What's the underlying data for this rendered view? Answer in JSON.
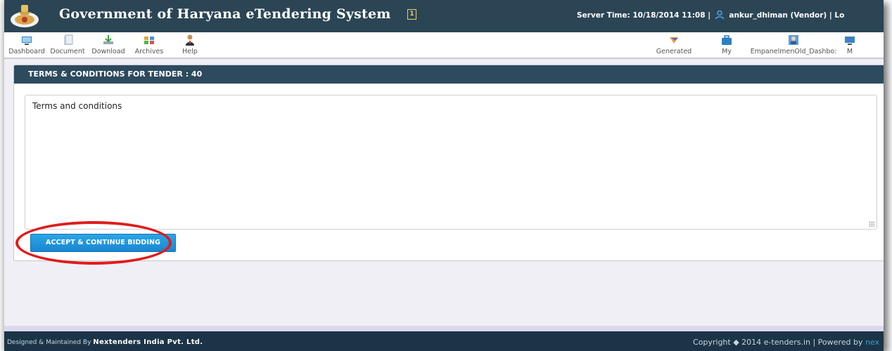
{
  "header": {
    "title": "Government of Haryana eTendering System",
    "badge": "1",
    "server_label": "Server Time: 10/18/2014 11:08",
    "separator": "|",
    "user": "ankur_dhiman (Vendor)",
    "separator2": "|",
    "truncated_link": "Lo"
  },
  "toolbar": {
    "left_items": [
      {
        "label": "Dashboard",
        "icon": "dashboard-icon"
      },
      {
        "label": "Document",
        "icon": "document-icon"
      },
      {
        "label": "Download",
        "icon": "download-icon"
      },
      {
        "label": "Archives",
        "icon": "archives-icon"
      },
      {
        "label": "Help",
        "icon": "help-icon"
      }
    ],
    "right_items": [
      {
        "label": "Generated",
        "icon": "generated-icon"
      },
      {
        "label": "My",
        "icon": "briefcase-icon"
      },
      {
        "label": "EmpanelmenOld_Dashbo:",
        "icon": "empanelment-icon"
      },
      {
        "label": "M",
        "icon": "monitor-icon"
      }
    ]
  },
  "panel": {
    "heading": "TERMS & CONDITIONS FOR TENDER : 40",
    "terms_text": "Terms and conditions",
    "accept_button": "ACCEPT & CONTINUE BIDDING"
  },
  "footer": {
    "designed_prefix": "Designed & Maintained By",
    "company": "Nextenders India Pvt. Ltd.",
    "copyright": "Copyright ◆ 2014 e-tenders.in | Powered by",
    "brand_tail": "nex"
  },
  "colors": {
    "header_bg": "#2b4555",
    "panel_head_bg": "#2d4a5e",
    "button_blue": "#1f95dc",
    "highlight_red": "#e01b1b",
    "footer_bg": "#1b3447"
  }
}
